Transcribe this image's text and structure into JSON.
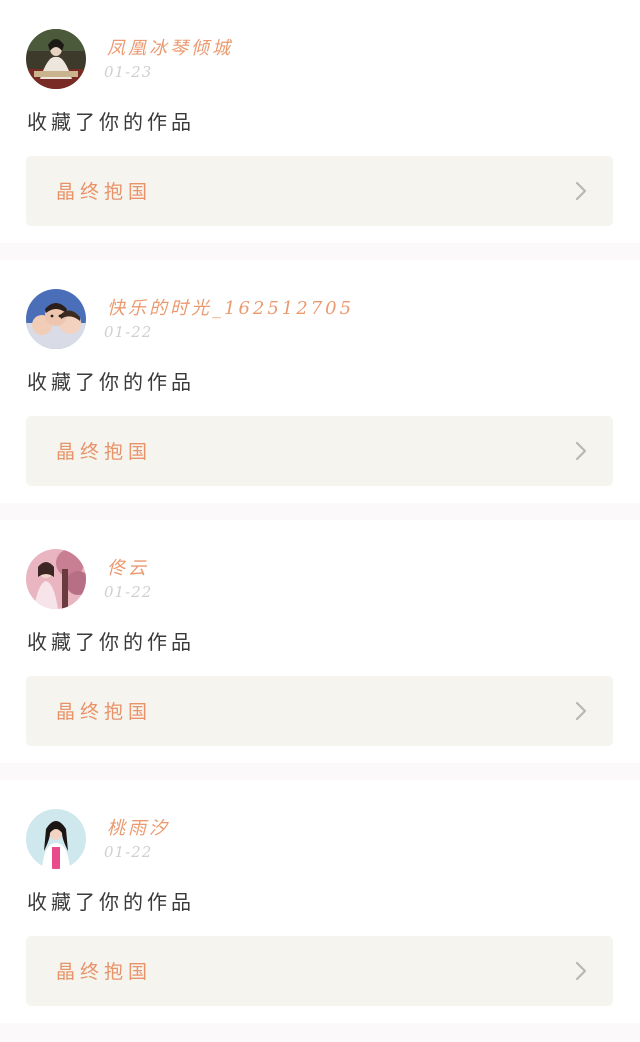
{
  "notifications": [
    {
      "username": "凤凰冰琴倾城",
      "date": "01-23",
      "action": "收藏了你的作品",
      "work_title": "晶终抱国",
      "avatar_icon": "avatar-photo-woman-white-dress"
    },
    {
      "username": "快乐的时光_162512705",
      "date": "01-22",
      "action": "收藏了你的作品",
      "work_title": "晶终抱国",
      "avatar_icon": "avatar-photo-children-group"
    },
    {
      "username": "佟云",
      "date": "01-22",
      "action": "收藏了你的作品",
      "work_title": "晶终抱国",
      "avatar_icon": "avatar-photo-pink-blossom"
    },
    {
      "username": "桃雨汐",
      "date": "01-22",
      "action": "收藏了你的作品",
      "work_title": "晶终抱国",
      "avatar_icon": "avatar-photo-woman-dark-hair"
    }
  ],
  "colors": {
    "username": "#eb9a6f",
    "work_title": "#e8936a",
    "work_card_bg": "#f6f4ee",
    "date": "#cfcfcf",
    "action_text": "#3a3a3a",
    "chevron": "#b7b7b7"
  }
}
